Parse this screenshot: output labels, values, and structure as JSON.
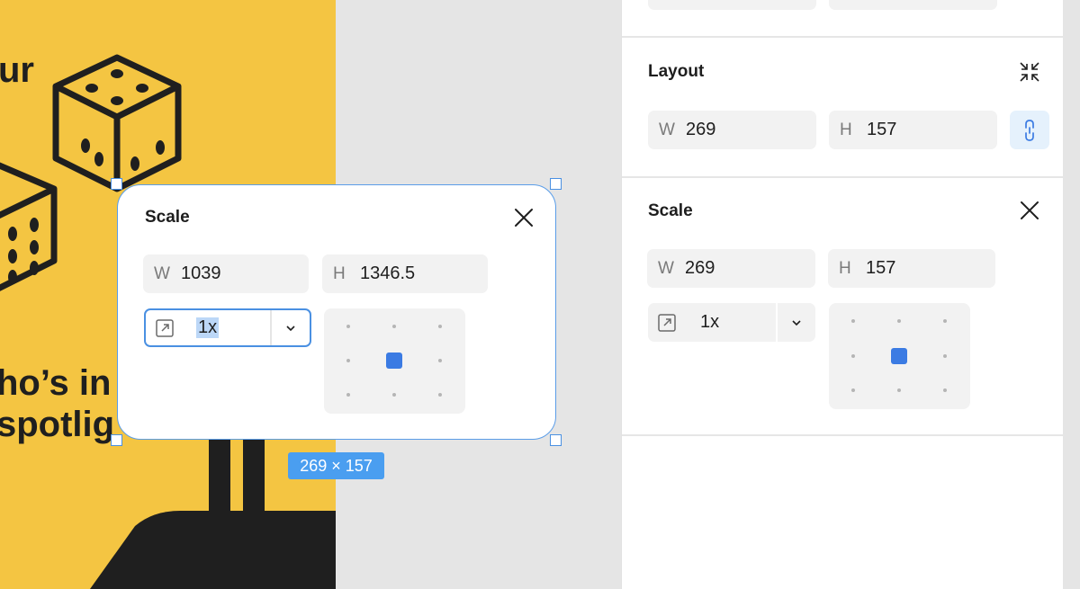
{
  "artwork": {
    "text_top": "ur",
    "text_mid1": "ho’s in",
    "text_mid2": "spotlig"
  },
  "floating_card": {
    "title": "Scale",
    "width_label": "W",
    "width_value": "1039",
    "height_label": "H",
    "height_value": "1346.5",
    "scale_value": "1x",
    "size_badge": "269 × 157",
    "icons": {
      "close": "close-icon",
      "scale": "scale-icon",
      "dropdown": "chevron-down-icon"
    }
  },
  "panel": {
    "layout": {
      "title": "Layout",
      "width_label": "W",
      "width_value": "269",
      "height_label": "H",
      "height_value": "157",
      "icons": {
        "collapse": "collapse-icon",
        "link": "link-icon"
      }
    },
    "scale": {
      "title": "Scale",
      "width_label": "W",
      "width_value": "269",
      "height_label": "H",
      "height_value": "157",
      "scale_value": "1x",
      "icons": {
        "close": "close-icon",
        "scale": "scale-icon",
        "dropdown": "chevron-down-icon"
      }
    }
  },
  "colors": {
    "accent": "#4a90e2",
    "anchor_active": "#3b7be3",
    "artwork_bg": "#f4c542",
    "canvas_bg": "#e5e5e5"
  }
}
